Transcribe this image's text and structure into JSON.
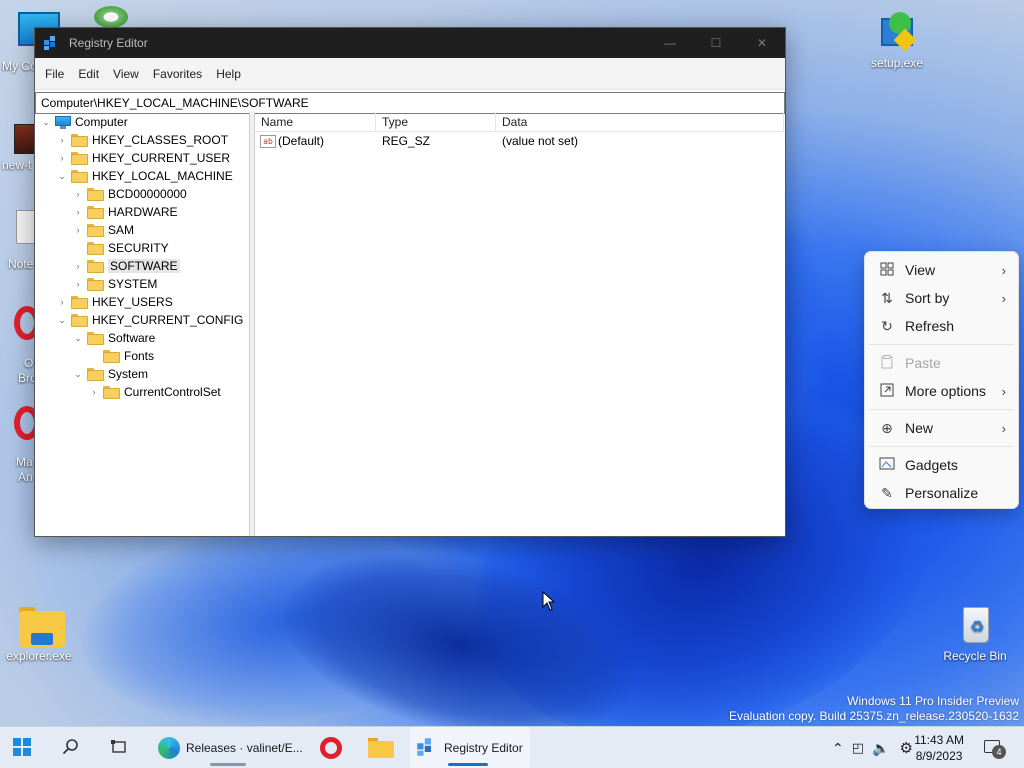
{
  "desktop": {
    "icons": {
      "my_computer": "My Co",
      "new_t": "new-t",
      "note": "Note",
      "o1_line1": "O",
      "o1_line2": "Bro",
      "ma_line1": "Ma",
      "ma_line2": "An",
      "setup": "setup.exe",
      "explorer": "explorer.exe",
      "recycle": "Recycle Bin"
    },
    "watermark_line1": "Windows 11 Pro Insider Preview",
    "watermark_line2": "Evaluation copy. Build 25375.zn_release.230520-1632"
  },
  "window": {
    "title": "Registry Editor",
    "controls": [
      "—",
      "☐",
      "✕"
    ],
    "menu": [
      "File",
      "Edit",
      "View",
      "Favorites",
      "Help"
    ],
    "address": "Computer\\HKEY_LOCAL_MACHINE\\SOFTWARE",
    "tree": {
      "root": "Computer",
      "hkcr": "HKEY_CLASSES_ROOT",
      "hkcu": "HKEY_CURRENT_USER",
      "hklm": "HKEY_LOCAL_MACHINE",
      "bcd": "BCD00000000",
      "hardware": "HARDWARE",
      "sam": "SAM",
      "security": "SECURITY",
      "software": "SOFTWARE",
      "system": "SYSTEM",
      "hku": "HKEY_USERS",
      "hkcc": "HKEY_CURRENT_CONFIG",
      "cc_software": "Software",
      "fonts": "Fonts",
      "cc_system": "System",
      "ccs": "CurrentControlSet"
    },
    "columns": {
      "name": "Name",
      "type": "Type",
      "data": "Data"
    },
    "values": [
      {
        "name": "(Default)",
        "type": "REG_SZ",
        "data": "(value not set)"
      }
    ]
  },
  "context_menu": {
    "items": [
      {
        "label": "View",
        "icon": "view-grid-icon",
        "submenu": true
      },
      {
        "label": "Sort by",
        "icon": "sort-icon",
        "submenu": true
      },
      {
        "label": "Refresh",
        "icon": "refresh-icon",
        "submenu": false
      },
      {
        "label": "Paste",
        "icon": "paste-icon",
        "submenu": false,
        "disabled": true
      },
      {
        "label": "More options",
        "icon": "more-options-icon",
        "submenu": true
      },
      {
        "label": "New",
        "icon": "new-icon",
        "submenu": true
      },
      {
        "label": "Gadgets",
        "icon": "gadgets-icon",
        "submenu": false
      },
      {
        "label": "Personalize",
        "icon": "personalize-icon",
        "submenu": false
      }
    ]
  },
  "taskbar": {
    "edge_label": "Releases · valinet/E...",
    "regedit_label": "Registry Editor",
    "time": "11:43 AM",
    "date": "8/9/2023",
    "notification_count": "4"
  }
}
